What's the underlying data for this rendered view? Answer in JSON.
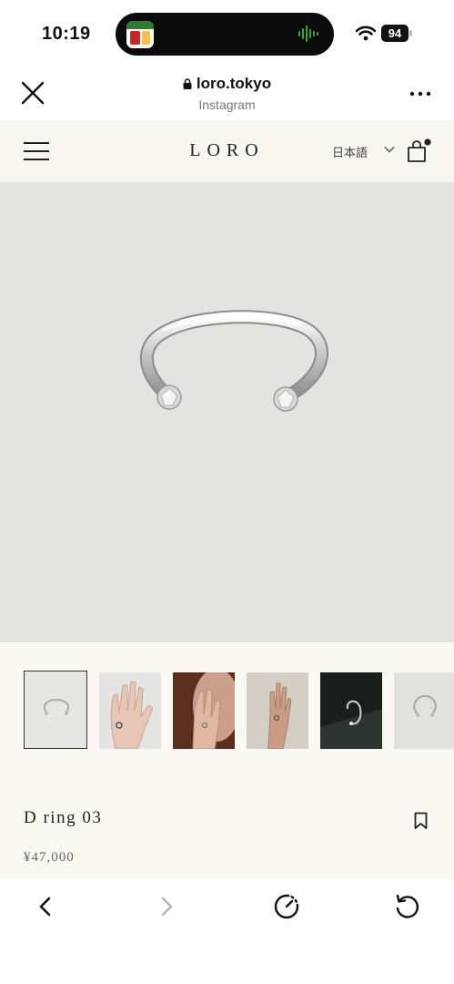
{
  "status": {
    "time": "10:19",
    "battery": "94",
    "island_app_icon": "app-icon",
    "audio_icon": "waveform-icon",
    "wifi_icon": "wifi-icon"
  },
  "browser": {
    "url": "loro.tokyo",
    "source": "Instagram",
    "close_icon": "close-icon",
    "lock_icon": "lock-icon",
    "more_icon": "more-icon"
  },
  "site": {
    "logo": "LORO",
    "language": "日本語",
    "menu_icon": "hamburger-icon",
    "cart_icon": "shopping-bag-icon",
    "background": "#f8f6f0"
  },
  "product": {
    "name": "D ring 03",
    "price": "¥47,000",
    "image_background": "#e3e3e2",
    "thumbnail_count": 6,
    "selected_thumbnail": 1
  },
  "toolbar": {
    "back_icon": "chevron-left-icon",
    "forward_icon": "chevron-right-icon",
    "speed_icon": "gauge-icon",
    "reload_icon": "reload-icon"
  }
}
